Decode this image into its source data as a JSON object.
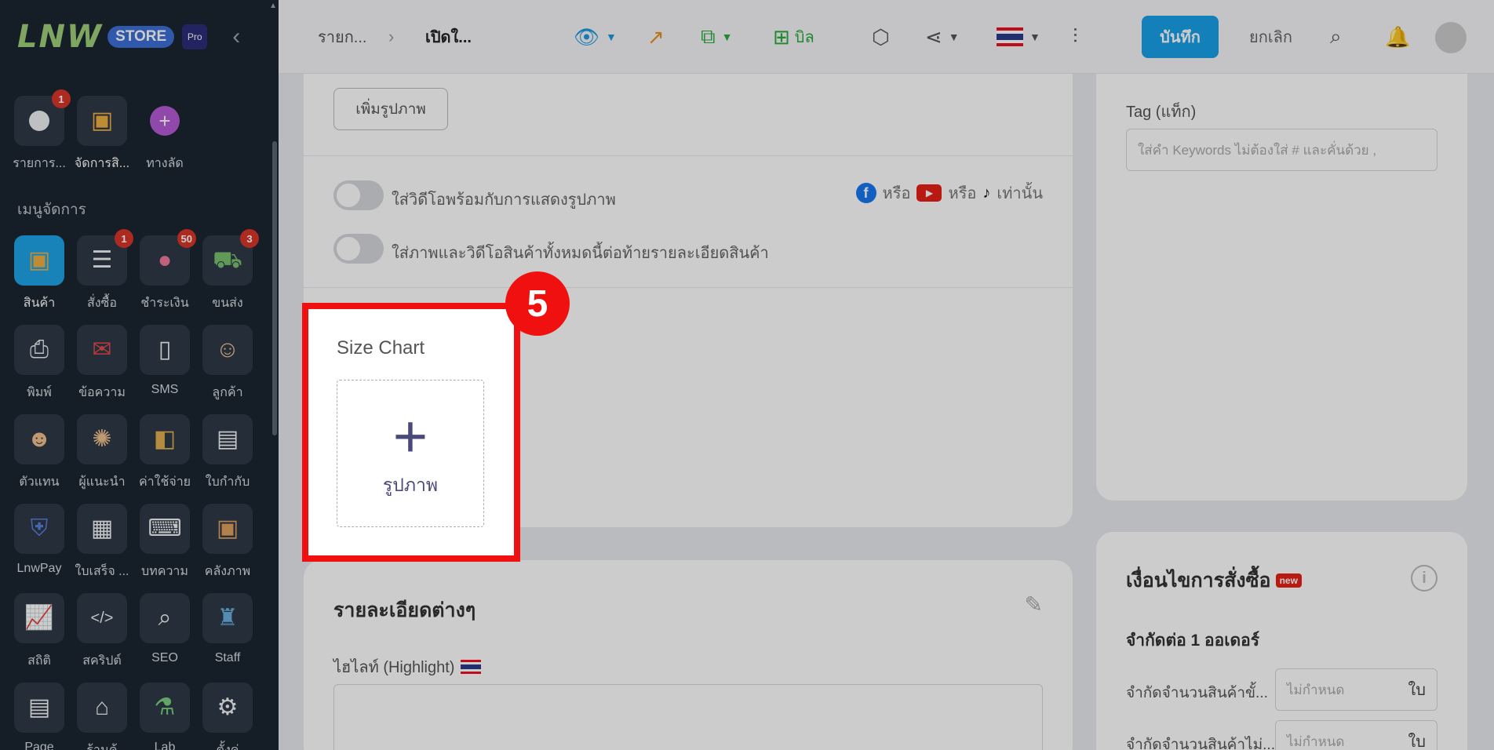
{
  "sidebar": {
    "logo_text": "LNW",
    "store_label": "STORE",
    "pro_label": "Pro",
    "quick_items": [
      {
        "label": "รายการ...",
        "badge": "1"
      },
      {
        "label": "จัดการสิ...",
        "badge": ""
      },
      {
        "label": "ทางลัด",
        "badge": ""
      }
    ],
    "section_title": "เมนูจัดการ",
    "menu_items": [
      {
        "label": "สินค้า",
        "badge": "",
        "icon": "box-icon"
      },
      {
        "label": "สั่งซื้อ",
        "badge": "1",
        "icon": "clipboard-icon"
      },
      {
        "label": "ชำระเงิน",
        "badge": "50",
        "icon": "piggy-bank-icon"
      },
      {
        "label": "ขนส่ง",
        "badge": "3",
        "icon": "truck-icon"
      },
      {
        "label": "พิมพ์",
        "badge": "",
        "icon": "printer-icon"
      },
      {
        "label": "ข้อความ",
        "badge": "",
        "icon": "mailbox-icon"
      },
      {
        "label": "SMS",
        "badge": "",
        "icon": "phone-icon"
      },
      {
        "label": "ลูกค้า",
        "badge": "",
        "icon": "customer-icon"
      },
      {
        "label": "ตัวแทน",
        "badge": "",
        "icon": "agents-icon"
      },
      {
        "label": "ผู้แนะนำ",
        "badge": "",
        "icon": "referrer-icon"
      },
      {
        "label": "ค่าใช้จ่าย",
        "badge": "",
        "icon": "wallet-icon"
      },
      {
        "label": "ใบกำกับ",
        "badge": "",
        "icon": "invoice-icon"
      },
      {
        "label": "LnwPay",
        "badge": "",
        "icon": "shield-icon"
      },
      {
        "label": "ใบเสร็จ ...",
        "badge": "",
        "icon": "receipt-icon"
      },
      {
        "label": "บทความ",
        "badge": "",
        "icon": "keyboard-icon"
      },
      {
        "label": "คลังภาพ",
        "badge": "",
        "icon": "gallery-icon"
      },
      {
        "label": "สถิติ",
        "badge": "",
        "icon": "stats-icon"
      },
      {
        "label": "สคริปต์",
        "badge": "",
        "icon": "code-icon"
      },
      {
        "label": "SEO",
        "badge": "",
        "icon": "seo-icon"
      },
      {
        "label": "Staff",
        "badge": "",
        "icon": "staff-icon"
      },
      {
        "label": "Page",
        "badge": "",
        "icon": "page-icon"
      },
      {
        "label": "ร้านค้",
        "badge": "",
        "icon": "storefront-icon"
      },
      {
        "label": "Lab",
        "badge": "",
        "icon": "flask-icon"
      },
      {
        "label": "ตั้งค่",
        "badge": "",
        "icon": "gear-icon"
      }
    ]
  },
  "topbar": {
    "breadcrumb_1": "รายก...",
    "breadcrumb_2": "เปิดใ...",
    "bill_label": "บิล",
    "save_label": "บันทึก",
    "cancel_label": "ยกเลิก"
  },
  "media": {
    "add_photo_label": "เพิ่มรูปภาพ",
    "video_toggle_label": "ใส่วิดีโอพร้อมกับการแสดงรูปภาพ",
    "or_1": "หรือ",
    "or_2": "หรือ",
    "only": "เท่านั้น",
    "append_toggle_label": "ใส่ภาพและวิดีโอสินค้าทั้งหมดนี้ต่อท้ายรายละเอียดสินค้า"
  },
  "size_chart": {
    "title": "Size Chart",
    "upload_label": "รูปภาพ",
    "step_number": "5"
  },
  "tag": {
    "label": "Tag (แท็ก)",
    "placeholder": "ใส่คำ Keywords ไม่ต้องใส่ # และคั่นด้วย ,"
  },
  "details": {
    "title": "รายละเอียดต่างๆ",
    "highlight_label": "ไฮไลท์ (Highlight)"
  },
  "order_conditions": {
    "title": "เงื่อนไขการสั่งซื้อ",
    "new_badge": "new",
    "subtitle": "จำกัดต่อ 1 ออเดอร์",
    "rows": [
      {
        "label": "จำกัดจำนวนสินค้าขั้...",
        "placeholder": "ไม่กำหนด",
        "unit": "ใบ"
      },
      {
        "label": "จำกัดจำนวนสินค้าไม่...",
        "placeholder": "ไม่กำหนด",
        "unit": "ใบ"
      }
    ]
  }
}
